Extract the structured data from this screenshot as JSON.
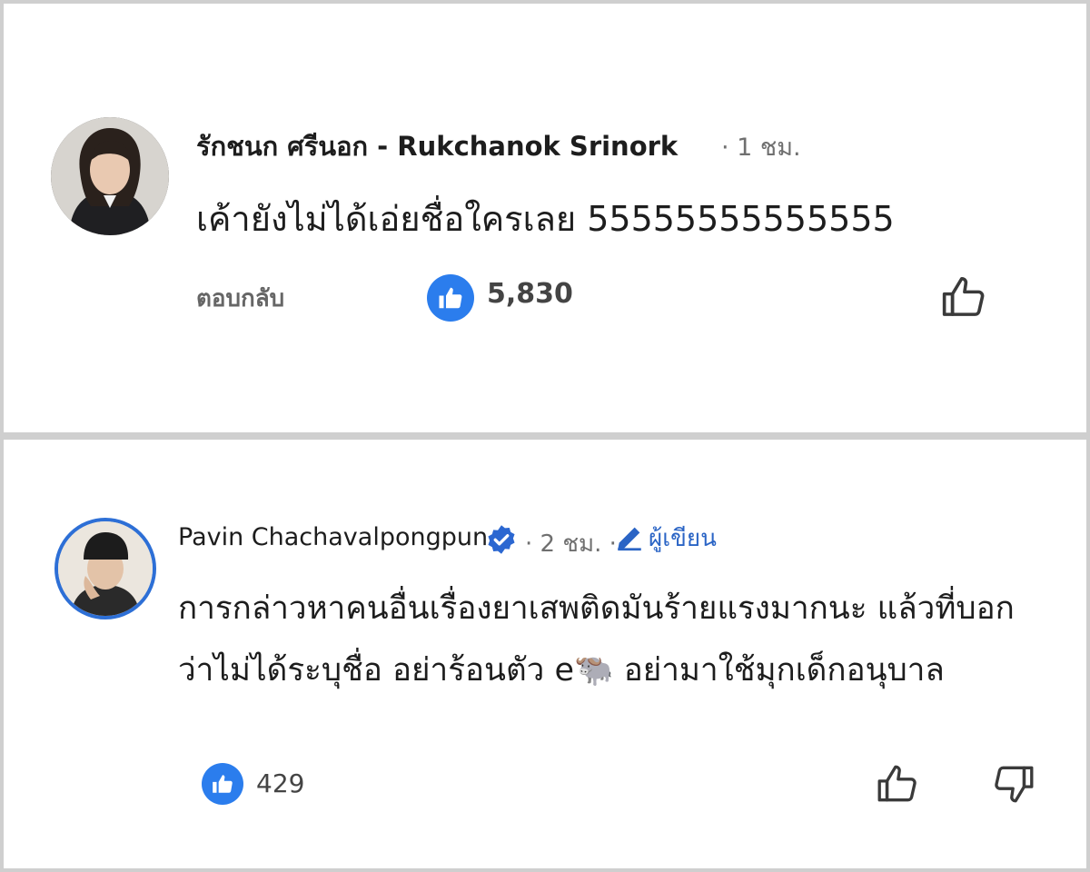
{
  "comment1": {
    "author": "รักชนก ศรีนอก - Rukchanok Srinork",
    "meta": "· 1 ชม.",
    "text": "เค้ายังไม่ได้เอ่ยชื่อใครเลย 55555555555555",
    "reply_label": "ตอบกลับ",
    "like_count": "5,830",
    "icons": [
      "avatar",
      "like-badge-icon",
      "thumbs-up-icon"
    ]
  },
  "comment2": {
    "author": "Pavin Chachavalpongpun",
    "meta": "· 2 ชม. ·",
    "author_tag": "ผู้เขียน",
    "text": "การกล่าวหาคนอื่นเรื่องยาเสพติดมันร้ายแรงมากนะ แล้วที่บอกว่าไม่ได้ระบุชื่อ อย่าร้อนตัว e🐃 อย่ามาใช้มุกเด็กอนุบาล",
    "like_count": "429",
    "icons": [
      "avatar",
      "verified-badge-icon",
      "pencil-icon",
      "like-badge-icon",
      "thumbs-up-icon",
      "thumbs-down-icon"
    ]
  },
  "colors": {
    "accent_blue": "#2b7ded",
    "author_tag_blue": "#2a64c5",
    "text": "#1d1d1d",
    "muted": "#6f6f6f"
  }
}
